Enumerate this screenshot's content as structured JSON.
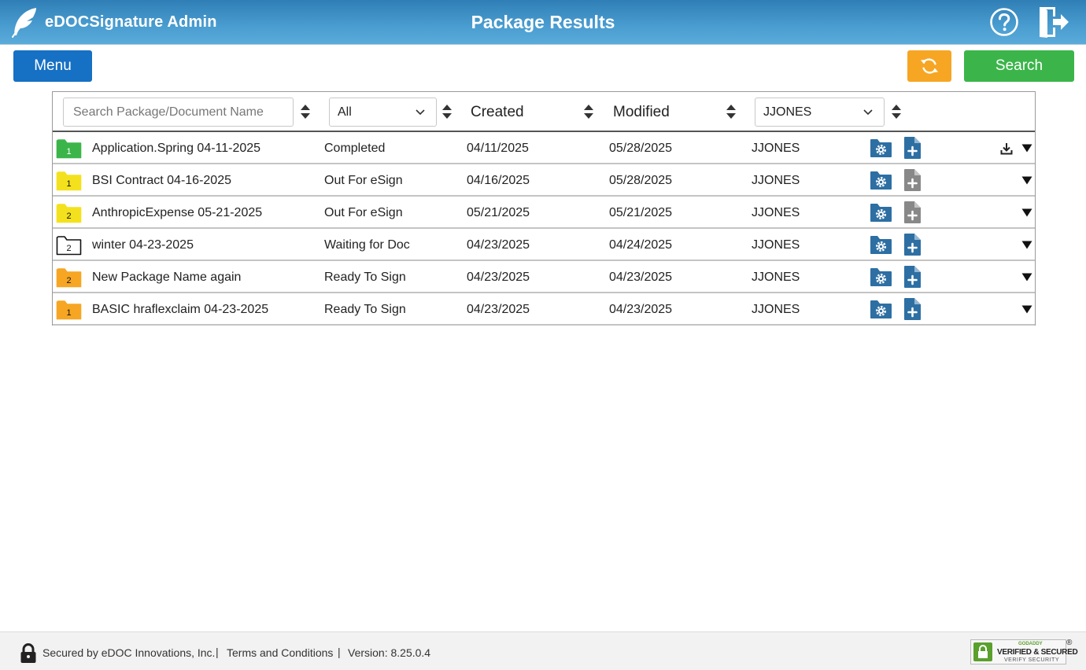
{
  "header": {
    "brand": "eDOCSignature Admin",
    "title": "Package Results",
    "help_icon": "help-circle-icon",
    "exit_icon": "exit-door-icon",
    "logo_icon": "feather-icon"
  },
  "toolbar": {
    "menu_label": "Menu",
    "refresh_icon": "refresh-icon",
    "search_label": "Search"
  },
  "filters": {
    "search_placeholder": "Search Package/Document Name",
    "search_value": "",
    "status_selected": "All",
    "created_label": "Created",
    "modified_label": "Modified",
    "user_selected": "JJONES"
  },
  "colors": {
    "header": "#3f92c8",
    "menu": "#1670c4",
    "refresh": "#f6a623",
    "search": "#3bb54a",
    "folder_green": "#3bb54a",
    "folder_yellow": "#f4e11d",
    "folder_orange": "#f6a623",
    "action_blue": "#2d6fa3",
    "action_gray": "#888888"
  },
  "rows": [
    {
      "count": "1",
      "folder_color": "green",
      "name": "Application.Spring 04-11-2025",
      "status": "Completed",
      "created": "04/11/2025",
      "modified": "05/28/2025",
      "user": "JJONES",
      "doc_enabled": true,
      "download": true
    },
    {
      "count": "1",
      "folder_color": "yellow",
      "name": "BSI Contract 04-16-2025",
      "status": "Out For eSign",
      "created": "04/16/2025",
      "modified": "05/28/2025",
      "user": "JJONES",
      "doc_enabled": false,
      "download": false
    },
    {
      "count": "2",
      "folder_color": "yellow",
      "name": "AnthropicExpense 05-21-2025",
      "status": "Out For eSign",
      "created": "05/21/2025",
      "modified": "05/21/2025",
      "user": "JJONES",
      "doc_enabled": false,
      "download": false
    },
    {
      "count": "2",
      "folder_color": "white",
      "name": "winter 04-23-2025",
      "status": "Waiting for Doc",
      "created": "04/23/2025",
      "modified": "04/24/2025",
      "user": "JJONES",
      "doc_enabled": true,
      "download": false
    },
    {
      "count": "2",
      "folder_color": "orange",
      "name": "New Package Name again",
      "status": "Ready To Sign",
      "created": "04/23/2025",
      "modified": "04/23/2025",
      "user": "JJONES",
      "doc_enabled": true,
      "download": false
    },
    {
      "count": "1",
      "folder_color": "orange",
      "name": "BASIC hraflexclaim 04-23-2025",
      "status": "Ready To Sign",
      "created": "04/23/2025",
      "modified": "04/23/2025",
      "user": "JJONES",
      "doc_enabled": true,
      "download": false
    }
  ],
  "footer": {
    "secured": "Secured by eDOC Innovations, Inc.",
    "sep": "|",
    "terms": "Terms and Conditions",
    "version": "Version: 8.25.0.4",
    "seal_top": "GODADDY",
    "seal_mid": "VERIFIED & SECURED",
    "seal_bot": "VERIFY SECURITY",
    "seal_reg": "®"
  }
}
